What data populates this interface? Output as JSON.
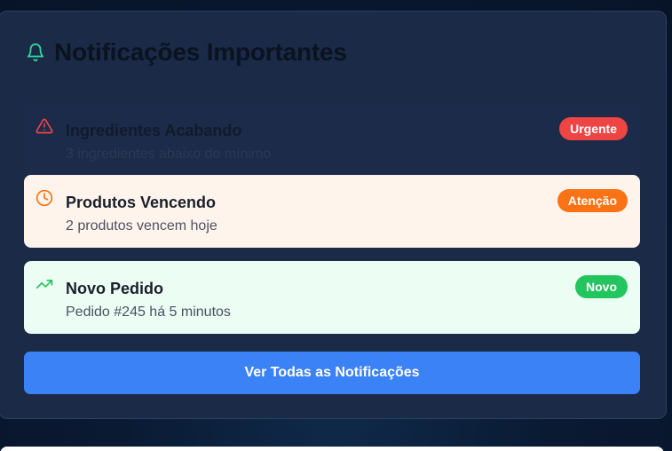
{
  "header": {
    "title": "Notificações Importantes",
    "icon": "bell-icon",
    "icon_color": "#34d399"
  },
  "notifications": [
    {
      "icon": "alert-triangle-icon",
      "icon_color": "#ef4444",
      "title": "Ingredientes Acabando",
      "subtitle": "3 ingredientes abaixo do mínimo",
      "badge": "Urgente",
      "badge_color": "#ef4444"
    },
    {
      "icon": "clock-icon",
      "icon_color": "#f97316",
      "title": "Produtos Vencendo",
      "subtitle": "2 produtos vencem hoje",
      "badge": "Atenção",
      "badge_color": "#f97316"
    },
    {
      "icon": "trending-up-icon",
      "icon_color": "#22c55e",
      "title": "Novo Pedido",
      "subtitle": "Pedido #245 há 5 minutos",
      "badge": "Novo",
      "badge_color": "#22c55e"
    }
  ],
  "actions": {
    "view_all_label": "Ver Todas as Notificações",
    "view_all_color": "#3b82f6"
  }
}
